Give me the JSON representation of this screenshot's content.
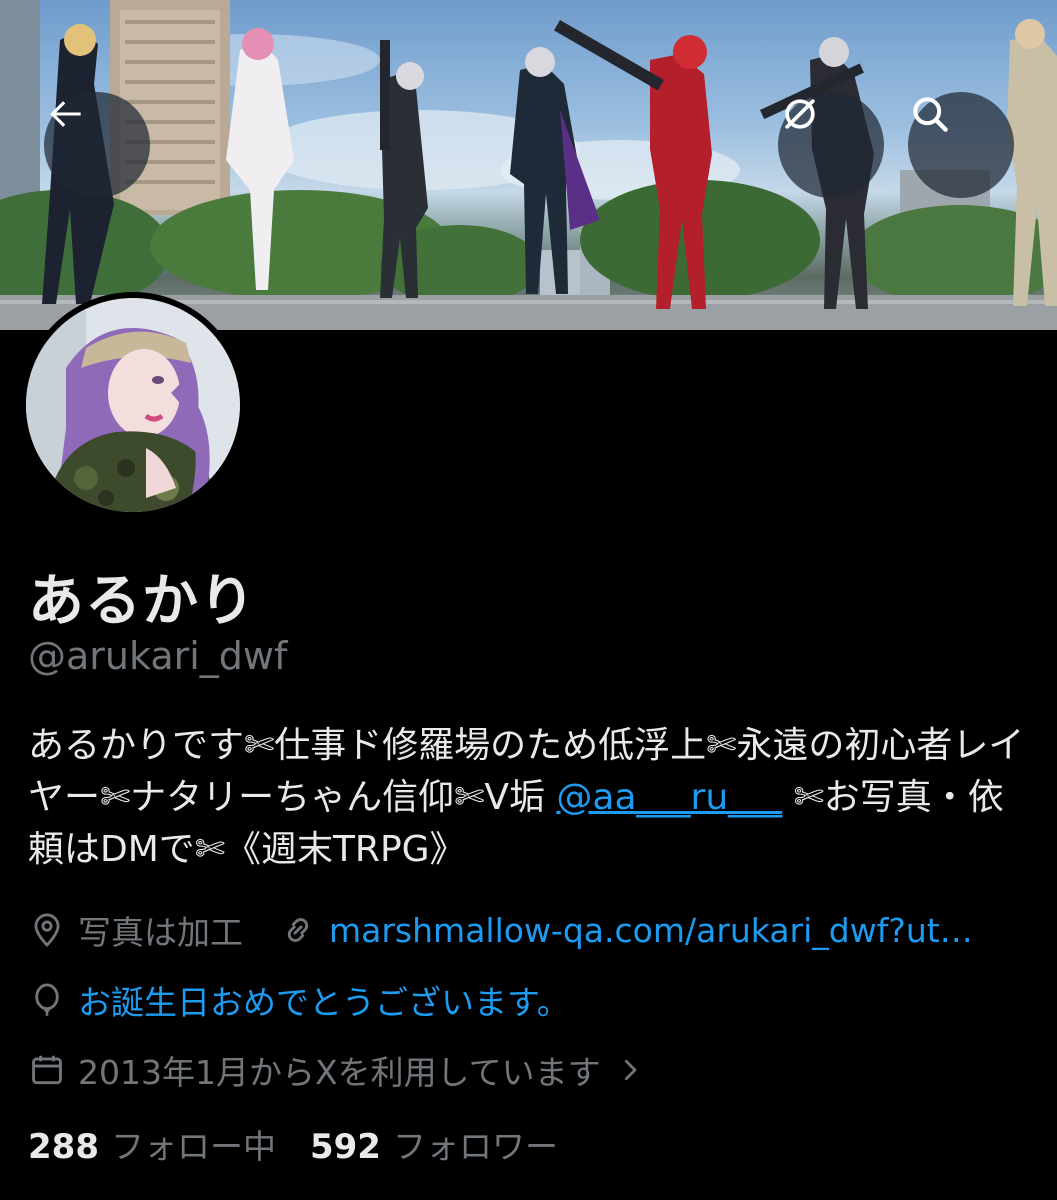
{
  "header": {
    "back_icon": "arrow-left-icon",
    "nofilter_icon": "no-filter-icon",
    "search_icon": "search-icon"
  },
  "profile": {
    "display_name": "あるかり",
    "handle": "@arukari_dwf",
    "bio_part1": "あるかりです✄仕事ド修羅場のため低浮上✄永遠の初心者レイヤー✄ナタリーちゃん信仰✄V垢 ",
    "bio_mention": "@aa___ru___",
    "bio_part2": " ✄お写真・依頼はDMで✄《週末TRPG》",
    "location": "写真は加工",
    "website": "marshmallow-qa.com/arukari_dwf?ut…",
    "birthday": "お誕生日おめでとうございます。",
    "joined": "2013年1月からXを利用しています",
    "following_count": "288",
    "following_label": "フォロー中",
    "followers_count": "592",
    "followers_label": "フォロワー"
  },
  "colors": {
    "background": "#000000",
    "text_primary": "#e7e9ea",
    "text_secondary": "#71767b",
    "accent": "#1d9bf0"
  }
}
